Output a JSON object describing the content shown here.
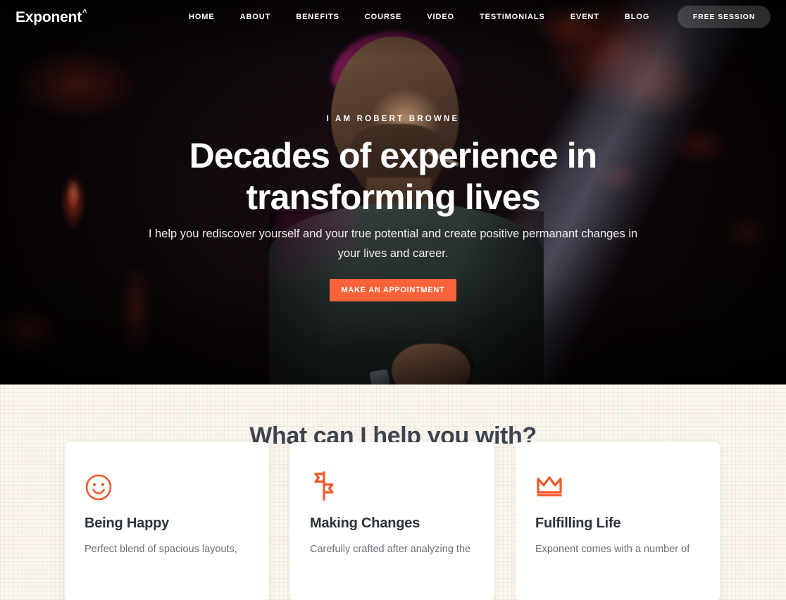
{
  "brand": {
    "name": "Exponent",
    "caret": "^"
  },
  "nav": {
    "items": [
      {
        "label": "HOME"
      },
      {
        "label": "ABOUT"
      },
      {
        "label": "BENEFITS"
      },
      {
        "label": "COURSE"
      },
      {
        "label": "VIDEO"
      },
      {
        "label": "TESTIMONIALS"
      },
      {
        "label": "EVENT"
      },
      {
        "label": "BLOG"
      }
    ],
    "cta_label": "FREE SESSION"
  },
  "hero": {
    "eyebrow": "I AM ROBERT BROWNE",
    "title": "Decades of experience in transforming lives",
    "subtitle": "I help you rediscover yourself and your true potential and create positive permanant changes in your lives and career.",
    "cta_label": "MAKE AN APPOINTMENT",
    "accent_color": "#FA6239"
  },
  "help": {
    "heading": "What can I help you with?",
    "background_color": "#FAF5EF",
    "heading_color": "#3C4450",
    "cards": [
      {
        "icon": "smiley-face-icon",
        "title": "Being Happy",
        "text": "Perfect blend of spacious layouts,"
      },
      {
        "icon": "signpost-icon",
        "title": "Making Changes",
        "text": "Carefully crafted after analyzing the"
      },
      {
        "icon": "crown-icon",
        "title": "Fulfilling Life",
        "text": "Exponent comes with a number of"
      }
    ]
  }
}
